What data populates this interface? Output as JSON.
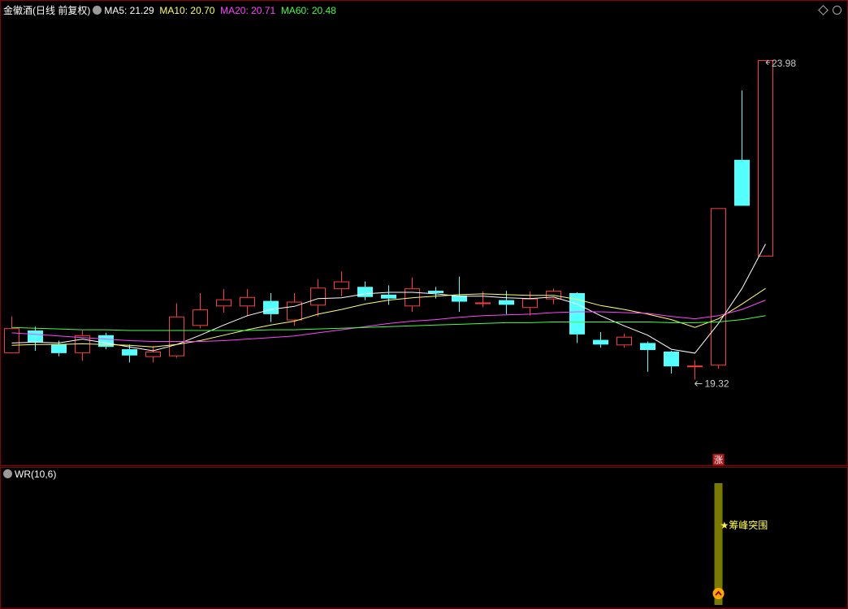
{
  "header": {
    "title": "金徽酒(日线 前复权)",
    "indicators": [
      {
        "label": "MA5: 21.29",
        "color": "#ffffff"
      },
      {
        "label": "MA10: 20.70",
        "color": "#ffff66"
      },
      {
        "label": "MA20: 20.71",
        "color": "#ff44ff"
      },
      {
        "label": "MA60: 20.48",
        "color": "#44ff44"
      }
    ]
  },
  "sub_panel": {
    "title": "WR(10,6)",
    "signal_text": "★筹峰突围"
  },
  "chart_data": {
    "type": "candlestick",
    "ylim": [
      19.0,
      24.5
    ],
    "annotations": {
      "high_label": "23.98",
      "low_label": "19.32",
      "limit_up_badge": "涨"
    },
    "candles": [
      {
        "o": 20.22,
        "c": 20.54,
        "h": 20.69,
        "l": 20.22
      },
      {
        "o": 20.51,
        "c": 20.36,
        "h": 20.56,
        "l": 20.25
      },
      {
        "o": 20.33,
        "c": 20.22,
        "h": 20.38,
        "l": 20.18
      },
      {
        "o": 20.22,
        "c": 20.45,
        "h": 20.51,
        "l": 20.12
      },
      {
        "o": 20.45,
        "c": 20.3,
        "h": 20.48,
        "l": 20.27
      },
      {
        "o": 20.27,
        "c": 20.19,
        "h": 20.33,
        "l": 20.1
      },
      {
        "o": 20.17,
        "c": 20.24,
        "h": 20.31,
        "l": 20.1
      },
      {
        "o": 20.18,
        "c": 20.69,
        "h": 20.86,
        "l": 20.16
      },
      {
        "o": 20.57,
        "c": 20.78,
        "h": 20.99,
        "l": 20.54
      },
      {
        "o": 20.82,
        "c": 20.91,
        "h": 21.04,
        "l": 20.74
      },
      {
        "o": 20.82,
        "c": 20.94,
        "h": 21.04,
        "l": 20.7
      },
      {
        "o": 20.89,
        "c": 20.72,
        "h": 20.99,
        "l": 20.62
      },
      {
        "o": 20.64,
        "c": 20.88,
        "h": 20.99,
        "l": 20.57
      },
      {
        "o": 20.83,
        "c": 21.06,
        "h": 21.17,
        "l": 20.69
      },
      {
        "o": 21.04,
        "c": 21.14,
        "h": 21.27,
        "l": 20.95
      },
      {
        "o": 21.07,
        "c": 20.94,
        "h": 21.14,
        "l": 20.9
      },
      {
        "o": 20.97,
        "c": 20.92,
        "h": 21.09,
        "l": 20.84
      },
      {
        "o": 20.82,
        "c": 21.05,
        "h": 21.19,
        "l": 20.75
      },
      {
        "o": 21.02,
        "c": 20.99,
        "h": 21.07,
        "l": 20.92
      },
      {
        "o": 20.96,
        "c": 20.88,
        "h": 21.2,
        "l": 20.75
      },
      {
        "o": 20.85,
        "c": 20.87,
        "h": 21.01,
        "l": 20.81
      },
      {
        "o": 20.9,
        "c": 20.84,
        "h": 21.02,
        "l": 20.72
      },
      {
        "o": 20.8,
        "c": 20.92,
        "h": 21.01,
        "l": 20.7
      },
      {
        "o": 20.91,
        "c": 21.02,
        "h": 21.05,
        "l": 20.85
      },
      {
        "o": 20.99,
        "c": 20.46,
        "h": 21.0,
        "l": 20.35
      },
      {
        "o": 20.39,
        "c": 20.33,
        "h": 20.49,
        "l": 20.29
      },
      {
        "o": 20.32,
        "c": 20.43,
        "h": 20.47,
        "l": 20.29
      },
      {
        "o": 20.35,
        "c": 20.26,
        "h": 20.37,
        "l": 19.98
      },
      {
        "o": 20.24,
        "c": 20.05,
        "h": 20.25,
        "l": 19.96
      },
      {
        "o": 20.04,
        "c": 20.06,
        "h": 20.13,
        "l": 19.88
      },
      {
        "o": 20.06,
        "c": 22.08,
        "h": 22.08,
        "l": 20.02
      },
      {
        "o": 22.7,
        "c": 22.11,
        "h": 23.59,
        "l": 22.11
      },
      {
        "o": 21.46,
        "c": 23.98,
        "h": 23.98,
        "l": 21.46
      }
    ],
    "series": [
      {
        "name": "MA5",
        "color": "#ffffff",
        "values": [
          20.35,
          20.36,
          20.35,
          20.4,
          20.35,
          20.3,
          20.25,
          20.33,
          20.45,
          20.58,
          20.7,
          20.78,
          20.82,
          20.92,
          20.93,
          20.98,
          21.0,
          21.0,
          20.98,
          20.95,
          20.95,
          20.93,
          20.92,
          20.94,
          20.85,
          20.7,
          20.57,
          20.45,
          20.27,
          20.22,
          20.6,
          21.05,
          21.62
        ]
      },
      {
        "name": "MA10",
        "color": "#ffff66",
        "values": [
          20.32,
          20.33,
          20.33,
          20.34,
          20.33,
          20.32,
          20.3,
          20.33,
          20.38,
          20.45,
          20.52,
          20.58,
          20.63,
          20.72,
          20.78,
          20.85,
          20.9,
          20.93,
          20.95,
          20.97,
          20.98,
          20.97,
          20.96,
          20.96,
          20.91,
          20.83,
          20.78,
          20.72,
          20.65,
          20.55,
          20.66,
          20.85,
          21.05
        ]
      },
      {
        "name": "MA20",
        "color": "#ff44ff",
        "values": [
          20.48,
          20.46,
          20.44,
          20.42,
          20.4,
          20.38,
          20.37,
          20.37,
          20.37,
          20.38,
          20.4,
          20.42,
          20.44,
          20.48,
          20.52,
          20.56,
          20.6,
          20.63,
          20.65,
          20.68,
          20.7,
          20.71,
          20.72,
          20.74,
          20.75,
          20.75,
          20.74,
          20.73,
          20.69,
          20.66,
          20.7,
          20.78,
          20.9
        ]
      },
      {
        "name": "MA60",
        "color": "#44ff44",
        "values": [
          20.55,
          20.54,
          20.53,
          20.52,
          20.52,
          20.51,
          20.51,
          20.51,
          20.51,
          20.51,
          20.51,
          20.52,
          20.52,
          20.53,
          20.54,
          20.55,
          20.56,
          20.57,
          20.58,
          20.59,
          20.6,
          20.61,
          20.61,
          20.62,
          20.62,
          20.62,
          20.62,
          20.62,
          20.61,
          20.61,
          20.62,
          20.65,
          20.7
        ]
      }
    ]
  }
}
